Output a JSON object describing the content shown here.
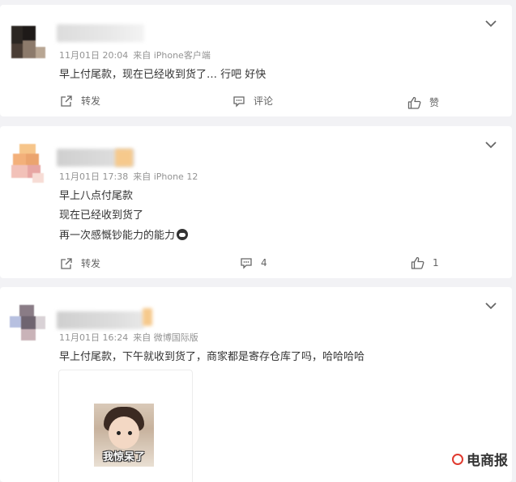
{
  "comments": [
    {
      "meta_date": "11月01日 20:04",
      "meta_source": "来自 iPhone客户端",
      "text_lines": [
        "早上付尾款，现在已经收到货了… 行吧 好快"
      ],
      "repost_label": "转发",
      "comment_label": "评论",
      "like_label": "赞"
    },
    {
      "meta_date": "11月01日 17:38",
      "meta_source": "来自 iPhone 12",
      "text_lines": [
        "早上八点付尾款",
        "现在已经收到货了",
        "再一次感慨钞能力的能力"
      ],
      "repost_label": "转发",
      "comment_label": "4",
      "like_label": "1"
    },
    {
      "meta_date": "11月01日 16:24",
      "meta_source": "来自 微博国际版",
      "text_lines": [
        "早上付尾款，下午就收到货了，商家都是寄存仓库了吗，哈哈哈哈"
      ],
      "image_caption": "我惊呆了"
    }
  ],
  "icons": {
    "collapse": "chevron-down-icon",
    "repost": "share-icon",
    "comment": "comment-icon",
    "like": "thumbs-up-icon",
    "emoji": "money-face-emoji"
  },
  "watermark": "电商报",
  "colors": {
    "background": "#f2f2f5",
    "card": "#ffffff",
    "meta_text": "#939393",
    "body_text": "#333333",
    "action_text": "#636363"
  }
}
